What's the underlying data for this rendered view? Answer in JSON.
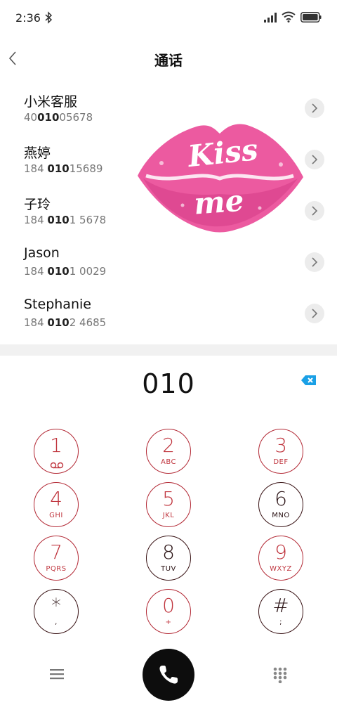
{
  "status_bar": {
    "time": "2:36",
    "icons": [
      "bluetooth-icon",
      "signal-icon",
      "wifi-icon",
      "battery-icon"
    ]
  },
  "header": {
    "title": "通话",
    "back_icon": "chevron-left-icon"
  },
  "contacts": [
    {
      "name": "小米客服",
      "number_pre": "40",
      "number_match": "010",
      "number_post": "05678"
    },
    {
      "name": "燕婷",
      "number_pre": "184 ",
      "number_match": "010",
      "number_post": "15689"
    },
    {
      "name": "子玲",
      "number_pre": "184 ",
      "number_match": "010",
      "number_post": "1 5678"
    },
    {
      "name": "Jason",
      "number_pre": "184 ",
      "number_match": "010",
      "number_post": "1 0029"
    },
    {
      "name": "Stephanie",
      "number_pre": "184 ",
      "number_match": "010",
      "number_post": "2 4685"
    }
  ],
  "sticker": {
    "line1": "Kiss",
    "line2": "me",
    "color": "#ec5aa0"
  },
  "dialer": {
    "input_value": "010",
    "backspace_icon": "backspace-icon",
    "accent_color": "#1aa0e6"
  },
  "keypad": [
    {
      "digit": "1",
      "letters": ""
    },
    {
      "digit": "2",
      "letters": "ABC"
    },
    {
      "digit": "3",
      "letters": "DEF"
    },
    {
      "digit": "4",
      "letters": "GHI"
    },
    {
      "digit": "5",
      "letters": "JKL"
    },
    {
      "digit": "6",
      "letters": "MNO"
    },
    {
      "digit": "7",
      "letters": "PQRS"
    },
    {
      "digit": "8",
      "letters": "TUV"
    },
    {
      "digit": "9",
      "letters": "WXYZ"
    },
    {
      "digit": "*",
      "letters": ","
    },
    {
      "digit": "0",
      "letters": "+"
    },
    {
      "digit": "#",
      "letters": ";"
    }
  ],
  "bottom_bar": {
    "menu_icon": "menu-icon",
    "call_icon": "phone-icon",
    "dialpad_icon": "dialpad-icon"
  },
  "colors": {
    "key_ring": "#b32a36",
    "call_button": "#0d0d0d"
  }
}
